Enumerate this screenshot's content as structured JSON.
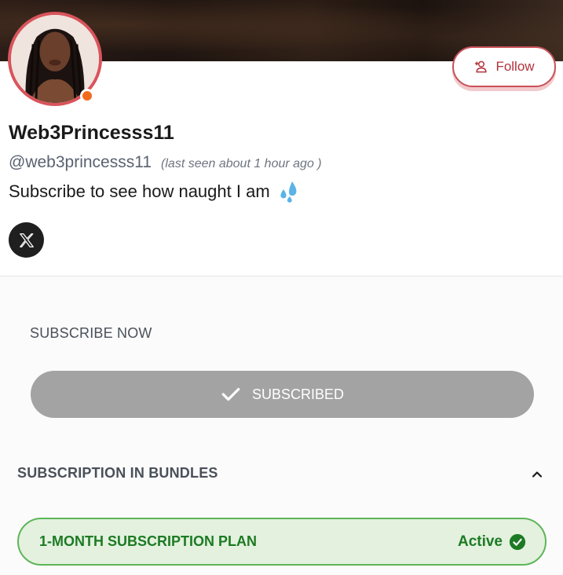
{
  "profile": {
    "display_name": "Web3Princesss11",
    "handle": "@web3princesss11",
    "last_seen": "(last seen about 1 hour ago )",
    "bio": "Subscribe to see how naught I am",
    "online_status_color": "#f26b1d"
  },
  "actions": {
    "follow_label": "Follow",
    "follow_icon": "user-plus-icon",
    "social_icon": "x-logo-icon"
  },
  "subscription": {
    "section_title": "SUBSCRIBE NOW",
    "subscribed_label": "SUBSCRIBED",
    "bundles_title": "SUBSCRIPTION IN BUNDLES",
    "bundles_expanded": true,
    "plan": {
      "name": "1-MONTH SUBSCRIPTION PLAN",
      "status": "Active"
    }
  },
  "colors": {
    "accent": "#c8515a",
    "subscribed_bg": "#a3a3a3",
    "active_green": "#1d7a24",
    "active_bg": "#e3f1de"
  }
}
